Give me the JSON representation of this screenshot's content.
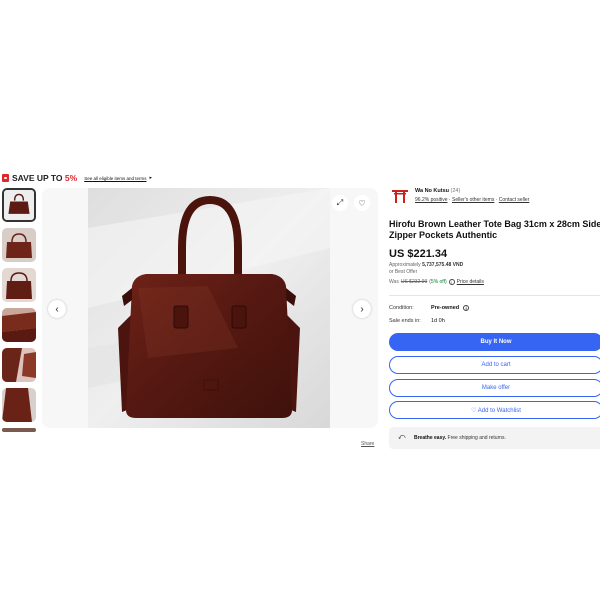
{
  "promo": {
    "title_prefix": "SAVE UP TO ",
    "title_percent": "5%",
    "link": "See all eligible items and terms",
    "arrow": "▸"
  },
  "gallery": {
    "prev_icon": "‹",
    "next_icon": "›",
    "expand_icon": "⤢",
    "watch_icon": "♡",
    "share_label": "Share"
  },
  "seller": {
    "name": "Wa No Kutsu",
    "count": "(24)",
    "positive": "96.2% positive",
    "other_items": "Seller's other items",
    "contact": "Contact seller",
    "separator": "·"
  },
  "listing": {
    "title": "Hirofu Brown Leather Tote Bag 31cm x 28cm Side & Zipper Pockets Authentic",
    "price": "US $221.34",
    "approx_label": "Approximately",
    "approx_value": "5,737,575.48 VND",
    "best_offer": "or Best Offer",
    "was_label": "Was",
    "was_price": "US $232.99",
    "discount": "(5% off)",
    "price_details": "Price details",
    "condition_label": "Condition:",
    "condition_value": "Pre-owned",
    "sale_label": "Sale ends in:",
    "sale_value": "1d 0h"
  },
  "actions": {
    "buy": "Buy It Now",
    "cart": "Add to cart",
    "offer": "Make offer",
    "watchlist": "♡ Add to Watchlist"
  },
  "shipping": {
    "bold": "Breathe easy.",
    "text": " Free shipping and returns."
  },
  "colors": {
    "accent": "#3665f3",
    "promo_red": "#e0262b",
    "leather": "#5a1a12"
  }
}
